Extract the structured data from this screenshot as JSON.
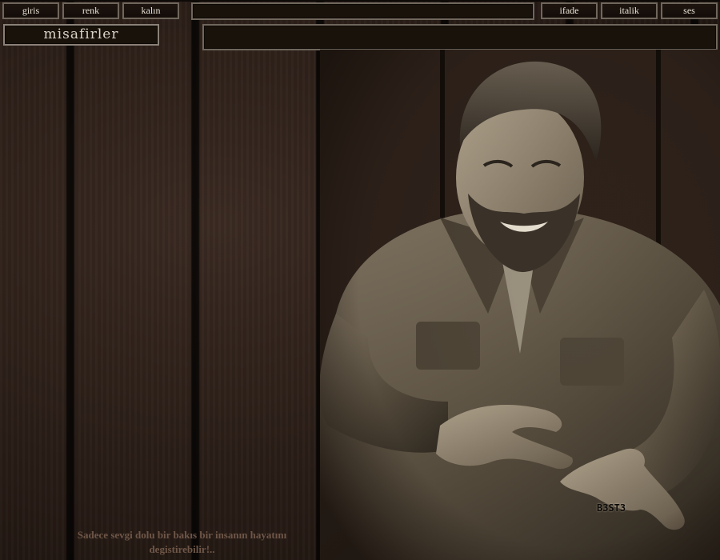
{
  "toolbar_left": {
    "login_label": "giris",
    "color_label": "renk",
    "bold_label": "kalın"
  },
  "toolbar_right": {
    "emote_label": "ifade",
    "italic_label": "italik",
    "sound_label": "ses"
  },
  "chat": {
    "message_input_value": "",
    "message_area_text": ""
  },
  "sidebar": {
    "guests_label": "misafirler"
  },
  "footer": {
    "quote_line1": "Sadece sevgi dolu bir bakıs bir insanın hayatını",
    "quote_line2": "degistirebilir!.."
  },
  "photo": {
    "watermark": "B3ST3"
  },
  "colors": {
    "wood_base": "#281c16",
    "button_border": "#6f665c",
    "quote_text": "#6e5648",
    "photo_tone": "sepia"
  }
}
